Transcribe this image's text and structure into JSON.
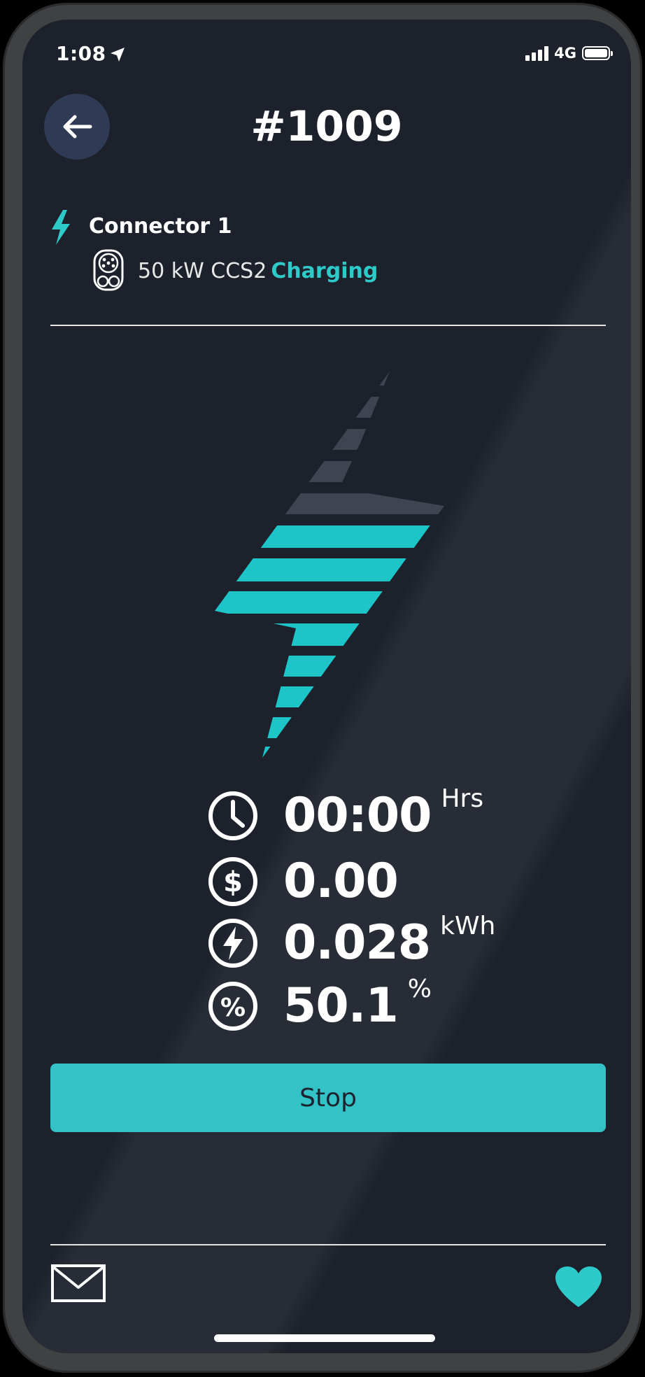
{
  "status_bar": {
    "time": "1:08",
    "network": "4G"
  },
  "header": {
    "title": "#1009"
  },
  "connector": {
    "name": "Connector 1",
    "spec": "50 kW CCS2",
    "status": "Charging"
  },
  "stats": {
    "duration": {
      "value": "00:00",
      "unit": "Hrs"
    },
    "cost": {
      "value": "0.00"
    },
    "energy": {
      "value": "0.028",
      "unit": "kWh"
    },
    "percent": {
      "value": "50.1",
      "unit": "%"
    }
  },
  "actions": {
    "stop_label": "Stop"
  },
  "colors": {
    "accent": "#2ec9c9",
    "background": "#1c212b",
    "button": "#33c2c6"
  },
  "icons": [
    "location-arrow-icon",
    "back-arrow-icon",
    "bolt-icon",
    "ccs2-plug-icon",
    "clock-icon",
    "dollar-icon",
    "energy-icon",
    "percent-icon",
    "mail-icon",
    "heart-icon"
  ]
}
